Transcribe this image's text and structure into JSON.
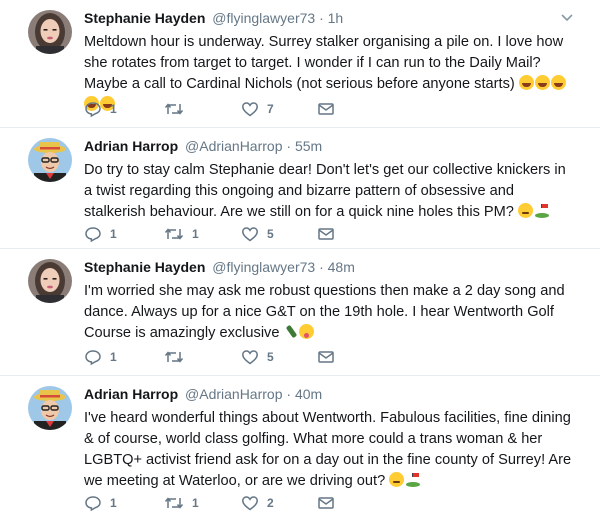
{
  "tweets": [
    {
      "name": "Stephanie Hayden",
      "handle": "@flyinglawyer73",
      "sep": "·",
      "time": "1h",
      "text": "Meltdown hour is underway. Surrey stalker organising a pile on. I love how she rotates from target to target. I wonder if I can run to the Daily Mail? Maybe a call to Cardinal Nichols (not serious before anyone starts)",
      "replies": "1",
      "retweets": "",
      "likes": "7"
    },
    {
      "name": "Adrian Harrop",
      "handle": "@AdrianHarrop",
      "sep": "·",
      "time": "55m",
      "text": "Do try to stay calm Stephanie dear! Don't let's get our collective knickers in a twist regarding this ongoing and bizarre pattern of obsessive and stalkerish behaviour. Are we still on for a quick nine holes this PM?",
      "replies": "1",
      "retweets": "1",
      "likes": "5"
    },
    {
      "name": "Stephanie Hayden",
      "handle": "@flyinglawyer73",
      "sep": "·",
      "time": "48m",
      "text": "I'm worried she may ask me robust questions then make a 2 day song and dance. Always up for a nice G&T on the 19th hole. I hear Wentworth Golf Course is amazingly exclusive",
      "replies": "1",
      "retweets": "",
      "likes": "5"
    },
    {
      "name": "Adrian Harrop",
      "handle": "@AdrianHarrop",
      "sep": "·",
      "time": "40m",
      "text": "I've heard wonderful things about Wentworth. Fabulous facilities, fine dining & of course, world class golfing. What more could a trans woman & her LGBTQ+ activist friend ask for on a day out in the fine county of Surrey! Are we meeting at Waterloo, or are we driving out?",
      "replies": "1",
      "retweets": "1",
      "likes": "2"
    }
  ],
  "icons": [
    "reply-icon",
    "retweet-icon",
    "like-icon",
    "dm-icon",
    "caret-down-icon"
  ],
  "colors": {
    "text": "#14171a",
    "muted": "#657786",
    "divider": "#e6ecf0"
  }
}
